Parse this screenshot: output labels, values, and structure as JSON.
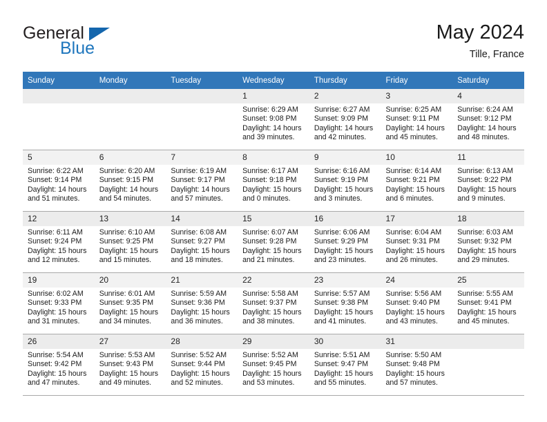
{
  "brand": {
    "name_top": "General",
    "name_bottom": "Blue",
    "triangle_color": "#1466ad",
    "blue_color": "#1e76bd",
    "dark_color": "#231f20"
  },
  "header": {
    "title": "May 2024",
    "subtitle": "Tille, France"
  },
  "theme": {
    "header_bg": "#3177b9",
    "header_text": "#ffffff",
    "daynum_bg": "#f0f0f0",
    "row_border": "#a9a9a9"
  },
  "weekdays": [
    "Sunday",
    "Monday",
    "Tuesday",
    "Wednesday",
    "Thursday",
    "Friday",
    "Saturday"
  ],
  "labels": {
    "sunrise_prefix": "Sunrise:",
    "sunset_prefix": "Sunset:",
    "daylight_prefix": "Daylight:"
  },
  "weeks": [
    [
      {
        "day": "",
        "empty": true
      },
      {
        "day": "",
        "empty": true
      },
      {
        "day": "",
        "empty": true
      },
      {
        "day": "1",
        "sunrise": "Sunrise: 6:29 AM",
        "sunset": "Sunset: 9:08 PM",
        "daylight": "Daylight: 14 hours and 39 minutes."
      },
      {
        "day": "2",
        "sunrise": "Sunrise: 6:27 AM",
        "sunset": "Sunset: 9:09 PM",
        "daylight": "Daylight: 14 hours and 42 minutes."
      },
      {
        "day": "3",
        "sunrise": "Sunrise: 6:25 AM",
        "sunset": "Sunset: 9:11 PM",
        "daylight": "Daylight: 14 hours and 45 minutes."
      },
      {
        "day": "4",
        "sunrise": "Sunrise: 6:24 AM",
        "sunset": "Sunset: 9:12 PM",
        "daylight": "Daylight: 14 hours and 48 minutes."
      }
    ],
    [
      {
        "day": "5",
        "sunrise": "Sunrise: 6:22 AM",
        "sunset": "Sunset: 9:14 PM",
        "daylight": "Daylight: 14 hours and 51 minutes."
      },
      {
        "day": "6",
        "sunrise": "Sunrise: 6:20 AM",
        "sunset": "Sunset: 9:15 PM",
        "daylight": "Daylight: 14 hours and 54 minutes."
      },
      {
        "day": "7",
        "sunrise": "Sunrise: 6:19 AM",
        "sunset": "Sunset: 9:17 PM",
        "daylight": "Daylight: 14 hours and 57 minutes."
      },
      {
        "day": "8",
        "sunrise": "Sunrise: 6:17 AM",
        "sunset": "Sunset: 9:18 PM",
        "daylight": "Daylight: 15 hours and 0 minutes."
      },
      {
        "day": "9",
        "sunrise": "Sunrise: 6:16 AM",
        "sunset": "Sunset: 9:19 PM",
        "daylight": "Daylight: 15 hours and 3 minutes."
      },
      {
        "day": "10",
        "sunrise": "Sunrise: 6:14 AM",
        "sunset": "Sunset: 9:21 PM",
        "daylight": "Daylight: 15 hours and 6 minutes."
      },
      {
        "day": "11",
        "sunrise": "Sunrise: 6:13 AM",
        "sunset": "Sunset: 9:22 PM",
        "daylight": "Daylight: 15 hours and 9 minutes."
      }
    ],
    [
      {
        "day": "12",
        "sunrise": "Sunrise: 6:11 AM",
        "sunset": "Sunset: 9:24 PM",
        "daylight": "Daylight: 15 hours and 12 minutes."
      },
      {
        "day": "13",
        "sunrise": "Sunrise: 6:10 AM",
        "sunset": "Sunset: 9:25 PM",
        "daylight": "Daylight: 15 hours and 15 minutes."
      },
      {
        "day": "14",
        "sunrise": "Sunrise: 6:08 AM",
        "sunset": "Sunset: 9:27 PM",
        "daylight": "Daylight: 15 hours and 18 minutes."
      },
      {
        "day": "15",
        "sunrise": "Sunrise: 6:07 AM",
        "sunset": "Sunset: 9:28 PM",
        "daylight": "Daylight: 15 hours and 21 minutes."
      },
      {
        "day": "16",
        "sunrise": "Sunrise: 6:06 AM",
        "sunset": "Sunset: 9:29 PM",
        "daylight": "Daylight: 15 hours and 23 minutes."
      },
      {
        "day": "17",
        "sunrise": "Sunrise: 6:04 AM",
        "sunset": "Sunset: 9:31 PM",
        "daylight": "Daylight: 15 hours and 26 minutes."
      },
      {
        "day": "18",
        "sunrise": "Sunrise: 6:03 AM",
        "sunset": "Sunset: 9:32 PM",
        "daylight": "Daylight: 15 hours and 29 minutes."
      }
    ],
    [
      {
        "day": "19",
        "sunrise": "Sunrise: 6:02 AM",
        "sunset": "Sunset: 9:33 PM",
        "daylight": "Daylight: 15 hours and 31 minutes."
      },
      {
        "day": "20",
        "sunrise": "Sunrise: 6:01 AM",
        "sunset": "Sunset: 9:35 PM",
        "daylight": "Daylight: 15 hours and 34 minutes."
      },
      {
        "day": "21",
        "sunrise": "Sunrise: 5:59 AM",
        "sunset": "Sunset: 9:36 PM",
        "daylight": "Daylight: 15 hours and 36 minutes."
      },
      {
        "day": "22",
        "sunrise": "Sunrise: 5:58 AM",
        "sunset": "Sunset: 9:37 PM",
        "daylight": "Daylight: 15 hours and 38 minutes."
      },
      {
        "day": "23",
        "sunrise": "Sunrise: 5:57 AM",
        "sunset": "Sunset: 9:38 PM",
        "daylight": "Daylight: 15 hours and 41 minutes."
      },
      {
        "day": "24",
        "sunrise": "Sunrise: 5:56 AM",
        "sunset": "Sunset: 9:40 PM",
        "daylight": "Daylight: 15 hours and 43 minutes."
      },
      {
        "day": "25",
        "sunrise": "Sunrise: 5:55 AM",
        "sunset": "Sunset: 9:41 PM",
        "daylight": "Daylight: 15 hours and 45 minutes."
      }
    ],
    [
      {
        "day": "26",
        "sunrise": "Sunrise: 5:54 AM",
        "sunset": "Sunset: 9:42 PM",
        "daylight": "Daylight: 15 hours and 47 minutes."
      },
      {
        "day": "27",
        "sunrise": "Sunrise: 5:53 AM",
        "sunset": "Sunset: 9:43 PM",
        "daylight": "Daylight: 15 hours and 49 minutes."
      },
      {
        "day": "28",
        "sunrise": "Sunrise: 5:52 AM",
        "sunset": "Sunset: 9:44 PM",
        "daylight": "Daylight: 15 hours and 52 minutes."
      },
      {
        "day": "29",
        "sunrise": "Sunrise: 5:52 AM",
        "sunset": "Sunset: 9:45 PM",
        "daylight": "Daylight: 15 hours and 53 minutes."
      },
      {
        "day": "30",
        "sunrise": "Sunrise: 5:51 AM",
        "sunset": "Sunset: 9:47 PM",
        "daylight": "Daylight: 15 hours and 55 minutes."
      },
      {
        "day": "31",
        "sunrise": "Sunrise: 5:50 AM",
        "sunset": "Sunset: 9:48 PM",
        "daylight": "Daylight: 15 hours and 57 minutes."
      },
      {
        "day": "",
        "empty": true
      }
    ]
  ]
}
